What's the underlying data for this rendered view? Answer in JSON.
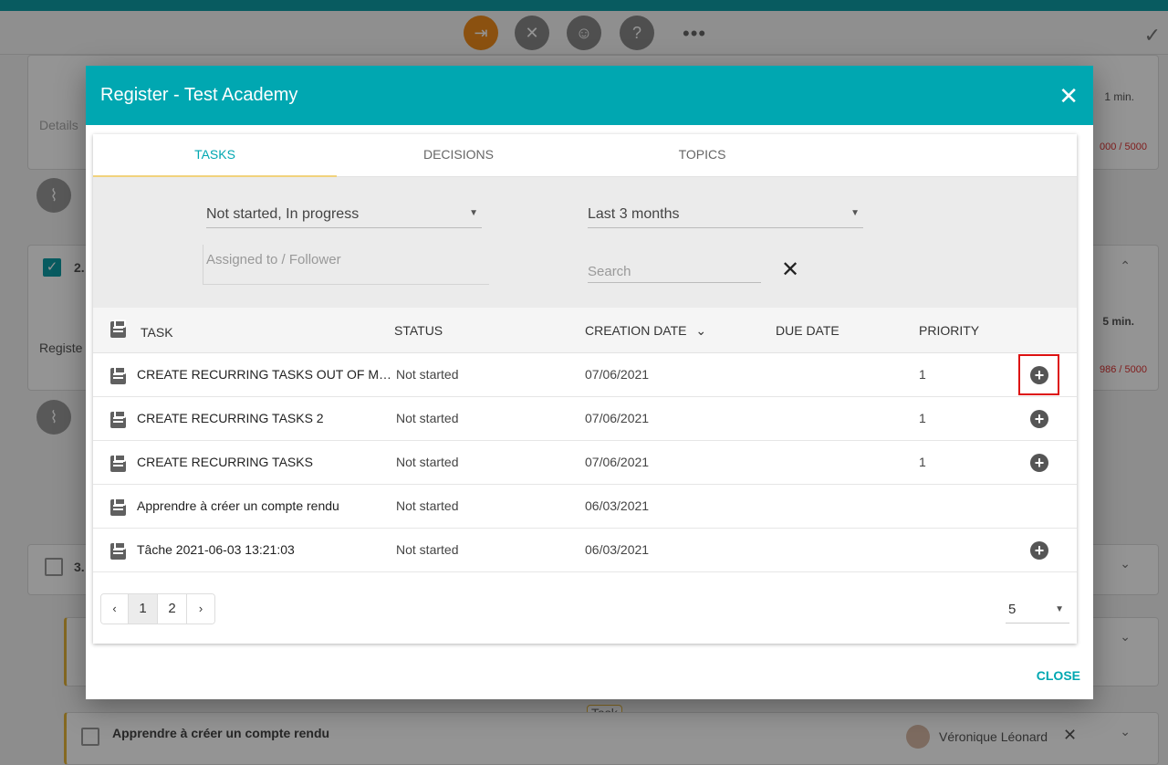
{
  "background": {
    "card1_placeholder": "Details",
    "card1_duration": "1 min.",
    "card1_count": "000 / 5000",
    "card2_number": "2.",
    "card2_text": "Registe",
    "card2_duration": "5 min.",
    "card2_count": "986 / 5000",
    "card3_number": "3.",
    "task_tag": "Task",
    "bottom_task_title": "Apprendre à créer un compte rendu",
    "bottom_task_assignee": "Véronique Léonard"
  },
  "modal": {
    "title": "Register  -  Test Academy",
    "close_label": "CLOSE",
    "tabs": [
      "TASKS",
      "DECISIONS",
      "TOPICS"
    ]
  },
  "filters": {
    "status": "Not started, In progress",
    "period": "Last 3 months",
    "assigned_placeholder": "Assigned to / Follower",
    "search_placeholder": "Search"
  },
  "table": {
    "headers": {
      "task": "TASK",
      "status": "STATUS",
      "creation_date": "CREATION DATE",
      "due_date": "DUE DATE",
      "priority": "PRIORITY"
    },
    "rows": [
      {
        "name": "CREATE RECURRING TASKS OUT OF MEETINGS",
        "status": "Not started",
        "creation_date": "07/06/2021",
        "due_date": "",
        "priority": "1",
        "has_add": true
      },
      {
        "name": "CREATE RECURRING TASKS 2",
        "status": "Not started",
        "creation_date": "07/06/2021",
        "due_date": "",
        "priority": "1",
        "has_add": true
      },
      {
        "name": "CREATE RECURRING TASKS",
        "status": "Not started",
        "creation_date": "07/06/2021",
        "due_date": "",
        "priority": "1",
        "has_add": true
      },
      {
        "name": "Apprendre à créer un compte rendu",
        "status": "Not started",
        "creation_date": "06/03/2021",
        "due_date": "",
        "priority": "",
        "has_add": false
      },
      {
        "name": "Tâche 2021-06-03 13:21:03",
        "status": "Not started",
        "creation_date": "06/03/2021",
        "due_date": "",
        "priority": "",
        "has_add": true
      }
    ]
  },
  "pagination": {
    "prev": "‹",
    "pages": [
      "1",
      "2"
    ],
    "next": "›",
    "per_page": "5"
  },
  "colors": {
    "accent": "#00a7b1",
    "highlight": "#dd1111",
    "orange_button": "#f08c1d"
  }
}
